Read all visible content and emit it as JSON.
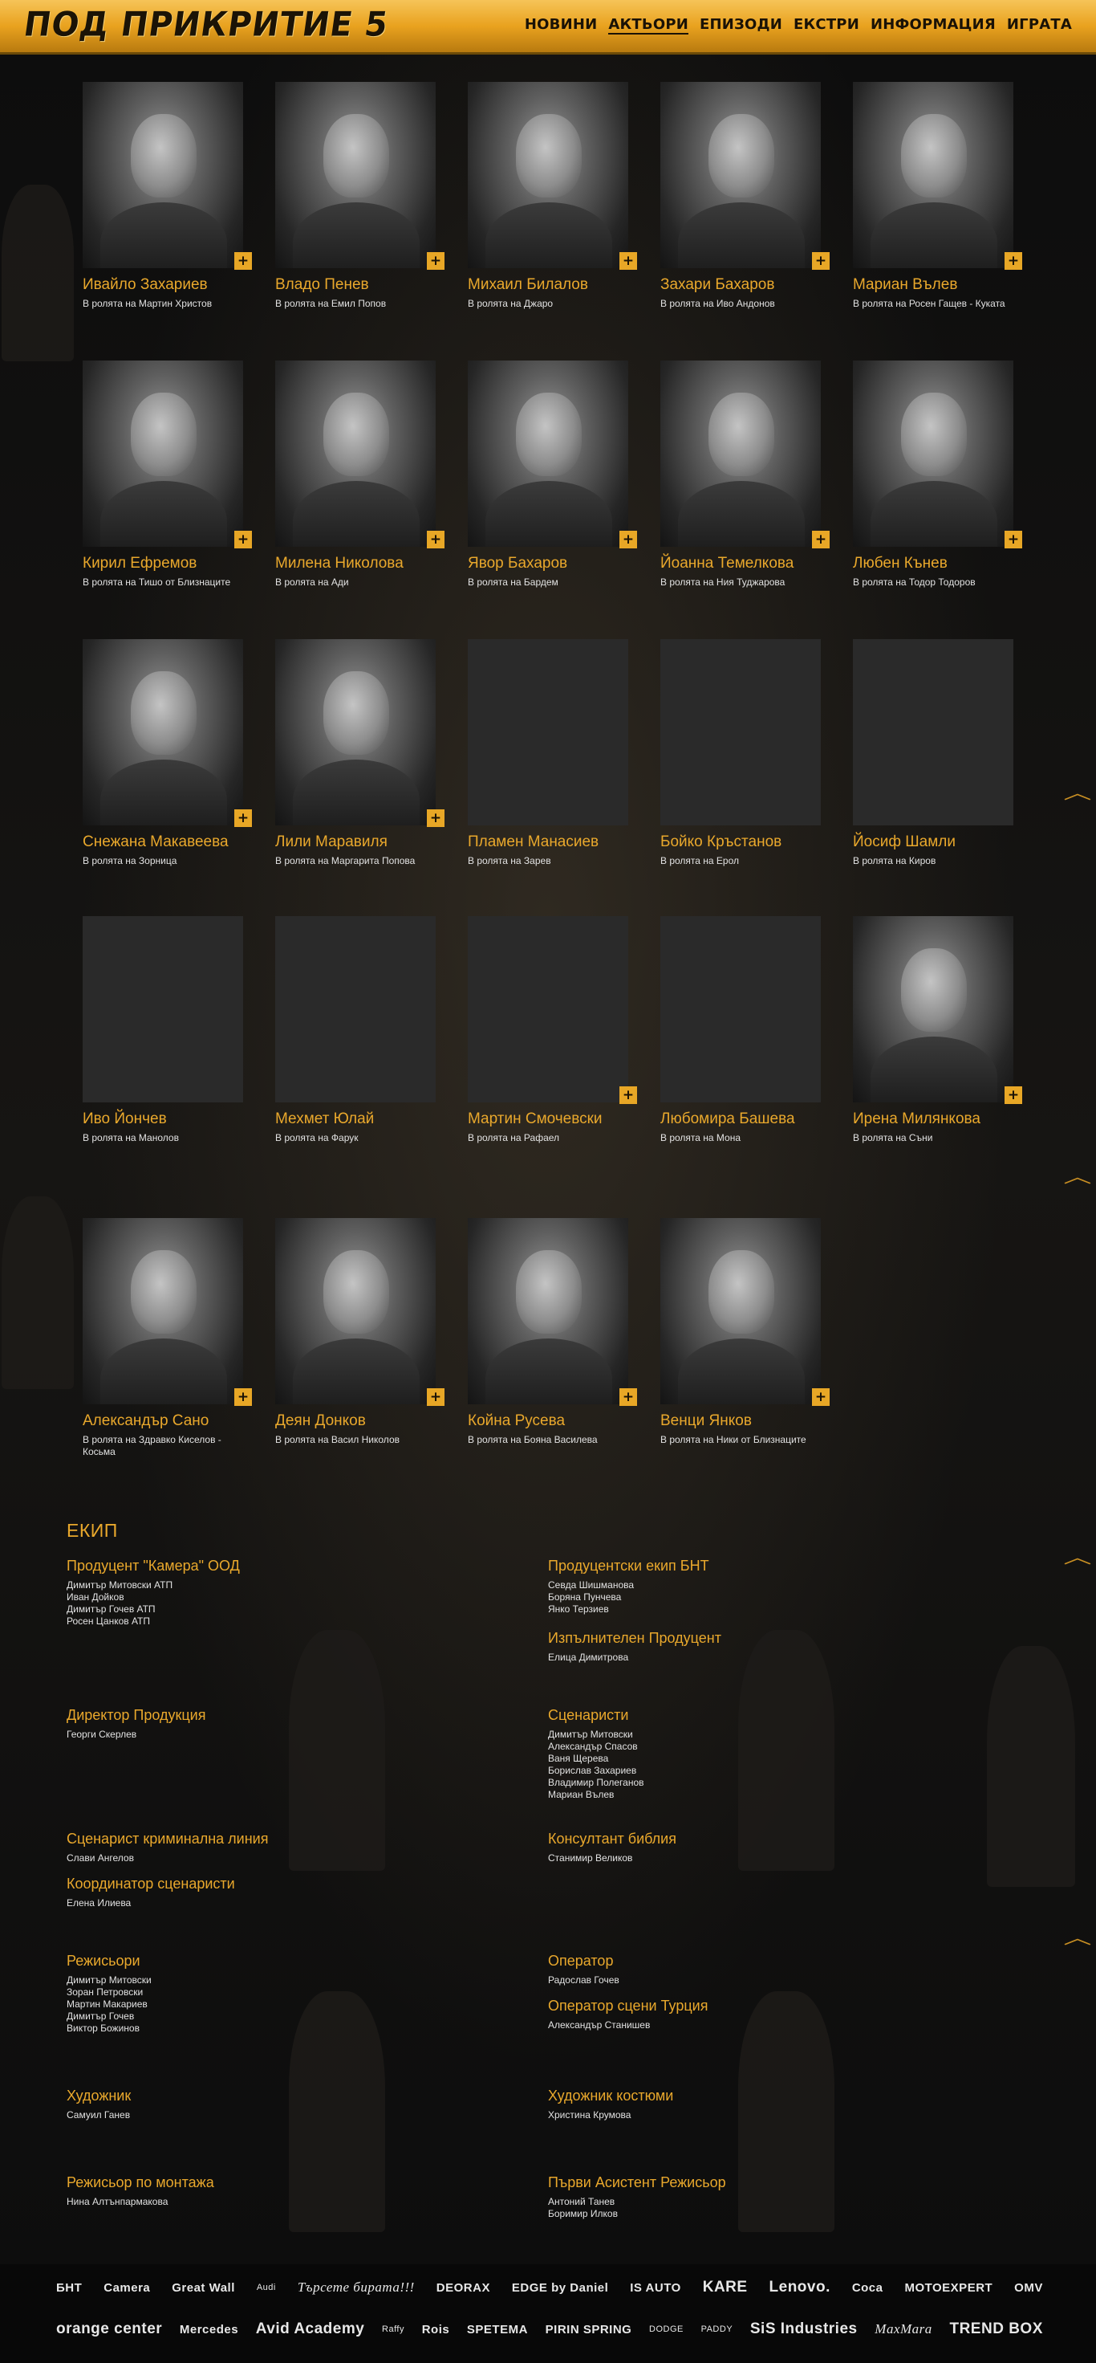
{
  "header": {
    "logo_text": "ПОД ПРИКРИТИЕ 5",
    "nav": [
      "НОВИНИ",
      "АКТЬОРИ",
      "ЕПИЗОДИ",
      "ЕКСТРИ",
      "ИНФОРМАЦИЯ",
      "ИГРАТА"
    ],
    "active_nav": "АКТЬОРИ"
  },
  "cast": [
    {
      "name": "Ивайло Захариев",
      "role": "В ролята на Мартин Христов",
      "photo": true
    },
    {
      "name": "Владо Пенев",
      "role": "В ролята на Емил Попов",
      "photo": true
    },
    {
      "name": "Михаил Билалов",
      "role": "В ролята на Джаро",
      "photo": true
    },
    {
      "name": "Захари Бахаров",
      "role": "В ролята на Иво Андонов",
      "photo": true
    },
    {
      "name": "Мариан Вълев",
      "role": "В ролята на Росен Гащев - Куката",
      "photo": true
    },
    {
      "name": "Кирил Ефремов",
      "role": "В ролята на Тишо от Близнаците",
      "photo": true
    },
    {
      "name": "Милена Николова",
      "role": "В ролята на Ади",
      "photo": true
    },
    {
      "name": "Явор Бахаров",
      "role": "В ролята на Бардем",
      "photo": true
    },
    {
      "name": "Йоанна Темелкова",
      "role": "В ролята на Ния Туджарова",
      "photo": true
    },
    {
      "name": "Любен Кънев",
      "role": "В ролята на Тодор Тодоров",
      "photo": true
    },
    {
      "name": "Снежана Макавеева",
      "role": "В ролята на Зорница",
      "photo": true
    },
    {
      "name": "Лили Маравиля",
      "role": "В ролята на Маргарита Попова",
      "photo": true
    },
    {
      "name": "Пламен Манасиев",
      "role": "В ролята на Зарев",
      "photo": false
    },
    {
      "name": "Бойко Кръстанов",
      "role": "В ролята на Ерол",
      "photo": false
    },
    {
      "name": "Йосиф Шамли",
      "role": "В ролята на Киров",
      "photo": false
    },
    {
      "name": "Иво Йончев",
      "role": "В ролята на Манолов",
      "photo": false
    },
    {
      "name": "Мехмет Юлай",
      "role": "В ролята на Фарук",
      "photo": false
    },
    {
      "name": "Мартин Смочевски",
      "role": "В ролята на Рафаел",
      "photo": false
    },
    {
      "name": "Любомира Башева",
      "role": "В ролята на Мона",
      "photo": false
    },
    {
      "name": "Ирена Милянкова",
      "role": "В ролята на Съни",
      "photo": true
    },
    {
      "name": "Александър Сано",
      "role": "В ролята на Здравко Киселов - Косьма",
      "photo": true
    },
    {
      "name": "Деян Донков",
      "role": "В ролята на Васил Николов",
      "photo": true
    },
    {
      "name": "Койна Русева",
      "role": "В ролята на Бояна Василева",
      "photo": true
    },
    {
      "name": "Венци Янков",
      "role": "В ролята на Ники от Близнаците",
      "photo": true
    }
  ],
  "plus_label": "+",
  "chevron_label": "︿",
  "crew": {
    "title": "ЕКИП",
    "blocks": [
      {
        "role": "Продуцент \"Камера\" ООД",
        "people": [
          "Димитър Митовски АТП",
          "Иван Дойков",
          "Димитър Гочев АТП",
          "Росен Цанков АТП"
        ]
      },
      {
        "role": "Продуцентски екип БНТ",
        "people": [
          "Севда Шишманова",
          "Боряна Пунчева",
          "Янко Терзиев"
        ]
      },
      {
        "role": "Изпълнителен Продуцент",
        "people": [
          "Елица Димитрова"
        ]
      },
      {
        "role": "Директор Продукция",
        "people": [
          "Георги Скерлев"
        ]
      },
      {
        "role": "Сценаристи",
        "people": [
          "Димитър Митовски",
          "Александър Спасов",
          "Ваня Щерева",
          "Борислав Захариев",
          "Владимир Полеганов",
          "Мариан Вълев"
        ]
      },
      {
        "role": "Сценарист криминална линия",
        "people": [
          "Слави Ангелов"
        ]
      },
      {
        "role": "Консултант библия",
        "people": [
          "Станимир Великов"
        ]
      },
      {
        "role": "Координатор сценаристи",
        "people": [
          "Елена Илиева"
        ]
      },
      {
        "role": "Режисьори",
        "people": [
          "Димитър Митовски",
          "Зоран Петровски",
          "Мартин Макариев",
          "Димитър Гочев",
          "Виктор Божинов"
        ]
      },
      {
        "role": "Оператор",
        "people": [
          "Радослав Гочев"
        ]
      },
      {
        "role": "Оператор сцени Турция",
        "people": [
          "Александър Станишев"
        ]
      },
      {
        "role": "Художник",
        "people": [
          "Самуил Ганев"
        ]
      },
      {
        "role": "Художник костюми",
        "people": [
          "Христина Крумова"
        ]
      },
      {
        "role": "Режисьор по монтажа",
        "people": [
          "Нина Алтънпармакова"
        ]
      },
      {
        "role": "Първи Асистент Режисьор",
        "people": [
          "Антоний Танев",
          "Боримир Илков"
        ]
      }
    ]
  },
  "sponsors": {
    "row1": [
      "БНТ",
      "Camera",
      "Great Wall",
      "Audi",
      "Търсете бирата!!!",
      "DEORAX",
      "EDGE by Daniel",
      "IS AUTO",
      "KARE",
      "Lenovo.",
      "Coca",
      "MOTOEXPERT",
      "OMV"
    ],
    "row2": [
      "orange center",
      "Mercedes",
      "Avid Academy",
      "Raffy",
      "Rois",
      "SPETEMA",
      "PIRIN SPRING",
      "DODGE",
      "PADDY",
      "SiS Industries",
      "MaxMara",
      "TREND BOX"
    ]
  }
}
